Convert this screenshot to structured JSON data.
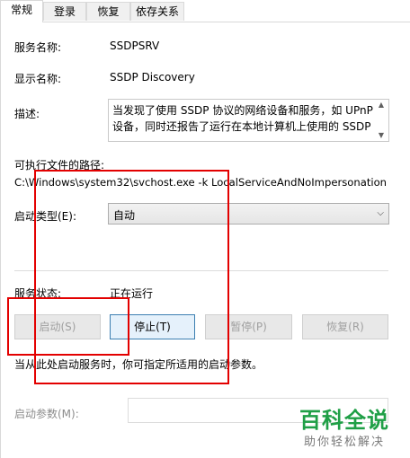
{
  "tabs": [
    {
      "label": "常规",
      "active": true
    },
    {
      "label": "登录",
      "active": false
    },
    {
      "label": "恢复",
      "active": false
    },
    {
      "label": "依存关系",
      "active": false
    }
  ],
  "service_name": {
    "label": "服务名称:",
    "value": "SSDPSRV"
  },
  "display_name": {
    "label": "显示名称:",
    "value": "SSDP Discovery"
  },
  "description": {
    "label": "描述:",
    "text": "当发现了使用 SSDP 协议的网络设备和服务，如 UPnP 设备，同时还报告了运行在本地计算机上使用的 SSDP"
  },
  "exe_path": {
    "label": "可执行文件的路径:",
    "value": "C:\\Windows\\system32\\svchost.exe -k LocalServiceAndNoImpersonation"
  },
  "startup_type": {
    "label": "启动类型(E):",
    "value": "自动"
  },
  "service_status": {
    "label": "服务状态:",
    "value": "正在运行"
  },
  "buttons": {
    "start": "启动(S)",
    "stop": "停止(T)",
    "pause": "暂停(P)",
    "resume": "恢复(R)"
  },
  "hint": "当从此处启动服务时，你可指定所适用的启动参数。",
  "start_params": {
    "label": "启动参数(M):",
    "value": ""
  },
  "watermark": {
    "title": "百科全说",
    "subtitle": "助你轻松解决"
  },
  "colors": {
    "highlight": "#e30000",
    "watermark": "#1f9f46"
  }
}
